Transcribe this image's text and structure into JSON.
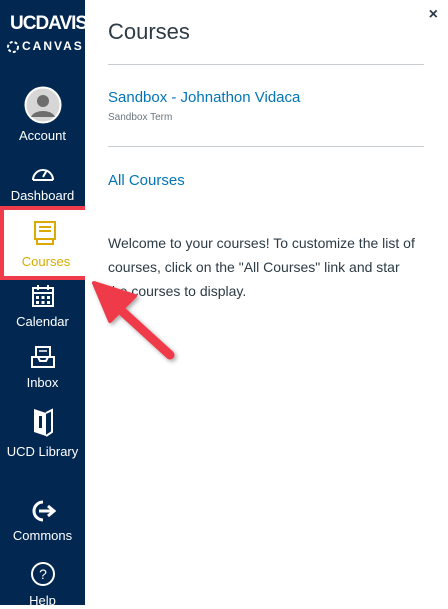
{
  "brand": {
    "line1": "UCDAVIS",
    "line2": "CANVAS",
    "colors": {
      "navy": "#022851",
      "gold": "#daaa00",
      "highlight": "#ef3b4a",
      "link": "#0374b5"
    }
  },
  "sidebar": {
    "items": [
      {
        "label": "Account",
        "icon": "avatar-icon"
      },
      {
        "label": "Dashboard",
        "icon": "dashboard-icon"
      },
      {
        "label": "Courses",
        "icon": "courses-icon",
        "active": true
      },
      {
        "label": "Calendar",
        "icon": "calendar-icon"
      },
      {
        "label": "Inbox",
        "icon": "inbox-icon"
      },
      {
        "label": "UCD Library",
        "icon": "library-icon"
      },
      {
        "label": "Commons",
        "icon": "commons-icon"
      },
      {
        "label": "Help",
        "icon": "help-icon"
      }
    ]
  },
  "panel": {
    "title": "Courses",
    "close_label": "×",
    "courses": [
      {
        "name": "Sandbox - Johnathon Vidaca",
        "term": "Sandbox Term"
      }
    ],
    "all_courses_label": "All Courses",
    "welcome_text": "Welcome to your courses! To customize the list of courses, click on the \"All Courses\" link and star the courses to display."
  }
}
